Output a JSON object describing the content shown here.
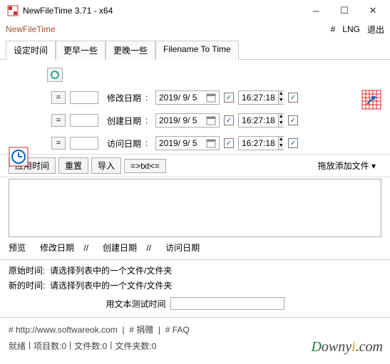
{
  "window": {
    "title": "NewFileTime 3.71 - x64",
    "app_name": "NewFileTime"
  },
  "menu": {
    "hash": "#",
    "lng": "LNG",
    "exit": "退出"
  },
  "tabs": {
    "set_time": "设定时间",
    "earlier": "更早一些",
    "later": "更晚一些",
    "fn2time": "Filename To Time"
  },
  "rows": {
    "eq": "=",
    "modify": {
      "label": "修改日期",
      "date": "2019/ 9/ 5",
      "time": "16:27:18"
    },
    "create": {
      "label": "创建日期",
      "date": "2019/ 9/ 5",
      "time": "16:27:18"
    },
    "access": {
      "label": "访问日期",
      "date": "2019/ 9/ 5",
      "time": "16:27:18"
    }
  },
  "actions": {
    "apply": "应用时间",
    "reset": "重置",
    "import": "导入",
    "txtio": "=>txt<=",
    "drop": "拖放添加文件",
    "arrow": "▾"
  },
  "preview": {
    "label": "预览",
    "sep": "//",
    "modify": "修改日期",
    "create": "创建日期",
    "access": "访问日期"
  },
  "info": {
    "orig_label": "原始时间:",
    "new_label": "新的时间:",
    "hint": "请选择列表中的一个文件/文件夹"
  },
  "test": {
    "label": "用文本测试时间"
  },
  "footer": {
    "link": "# http://www.softwareok.com",
    "donate": "# 捐赠",
    "faq": "# FAQ",
    "sep": "|"
  },
  "status": {
    "ready": "就绪",
    "items": "项目数:0",
    "files": "文件数:0",
    "folders": "文件夹数:0",
    "sep": "|"
  },
  "watermark": {
    "d": "D",
    "rest": "owny",
    "dot": "i",
    "com": ".com"
  },
  "check": "✓"
}
